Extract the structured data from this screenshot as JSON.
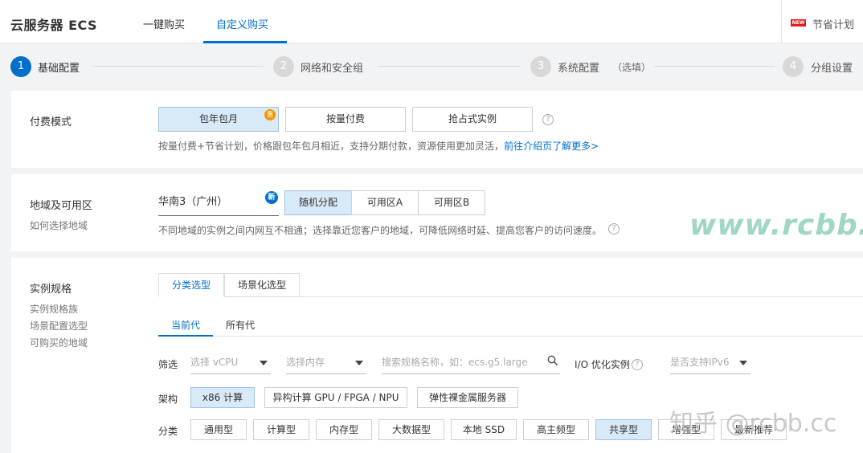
{
  "header": {
    "title": "云服务器 ECS",
    "tabs": [
      {
        "label": "一键购买"
      },
      {
        "label": "自定义购买"
      }
    ],
    "new_badge": "NEW",
    "savings_plan": "节省计划"
  },
  "steps": [
    {
      "num": "1",
      "label": "基础配置"
    },
    {
      "num": "2",
      "label": "网络和安全组"
    },
    {
      "num": "3",
      "label": "系统配置",
      "optional": "（选填）"
    },
    {
      "num": "4",
      "label": "分组设置"
    }
  ],
  "billing": {
    "title": "付费模式",
    "options": [
      "包年包月",
      "按量付费",
      "抢占式实例"
    ],
    "discount_badge": "惠",
    "note": "按量付费+节省计划，价格跟包年包月相近，支持分期付款，资源使用更加灵活，",
    "note_link": "前往介绍页了解更多>"
  },
  "region": {
    "title": "地域及可用区",
    "subtitle": "如何选择地域",
    "selected_region": "华南3（广州）",
    "new_badge": "新",
    "zones": [
      "随机分配",
      "可用区A",
      "可用区B"
    ],
    "note": "不同地域的实例之间内网互不相通；选择靠近您客户的地域，可降低网络时延、提高您客户的访问速度。"
  },
  "spec": {
    "title": "实例规格",
    "links": [
      "实例规格族",
      "场景配置选型",
      "可购买的地域"
    ],
    "tabs": [
      "分类选型",
      "场景化选型"
    ],
    "generation_tabs": [
      "当前代",
      "所有代"
    ],
    "filter_label": "筛选",
    "vcpu_placeholder": "选择 vCPU",
    "memory_placeholder": "选择内存",
    "search_placeholder": "搜索规格名称，如：ecs.g5.large",
    "io_label": "I/O 优化实例",
    "ipv6_placeholder": "是否支持IPv6",
    "arch_label": "架构",
    "arch_options": [
      "x86 计算",
      "异构计算 GPU / FPGA / NPU",
      "弹性裸金属服务器"
    ],
    "category_label": "分类",
    "categories": [
      "通用型",
      "计算型",
      "内存型",
      "大数据型",
      "本地 SSD",
      "高主频型",
      "共享型",
      "增强型",
      "最新推荐"
    ]
  },
  "watermarks": [
    "www.rcbb.cc",
    "知乎 @rcbb.cc"
  ]
}
